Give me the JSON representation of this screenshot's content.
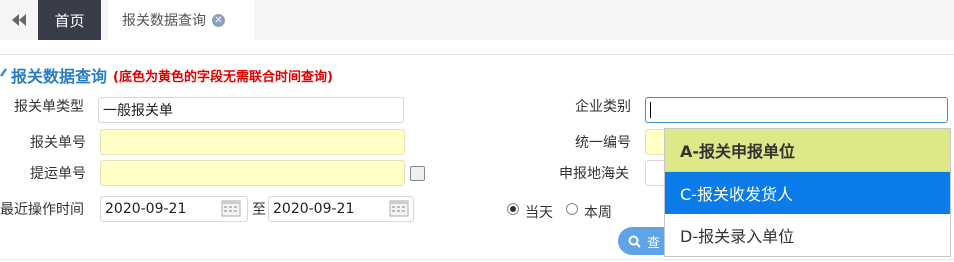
{
  "tabs": {
    "home_label": "首页",
    "active_label": "报关数据查询"
  },
  "header": {
    "title": "报关数据查询",
    "note": "(底色为黄色的字段无需联合时间查询)"
  },
  "form": {
    "declaration_type_label": "报关单类型",
    "declaration_type_value": "一般报关单",
    "enterprise_category_label": "企业类别",
    "declaration_no_label": "报关单号",
    "unified_no_label": "统一编号",
    "bill_no_label": "提运单号",
    "customs_label": "申报地海关",
    "last_op_time_label": "最近操作时间",
    "date_from": "2020-09-21",
    "date_to_label": "至",
    "date_to": "2020-09-21",
    "radio_today": "当天",
    "radio_week": "本周",
    "query_button": "查"
  },
  "dropdown": {
    "items": [
      "A-报关申报单位",
      "C-报关收发货人",
      "D-报关录入单位"
    ]
  },
  "colors": {
    "accent": "#2a7ec6",
    "required_bg": "#ffffc6",
    "selected": "#0a7be8",
    "dropdown_header": "#dee889"
  }
}
